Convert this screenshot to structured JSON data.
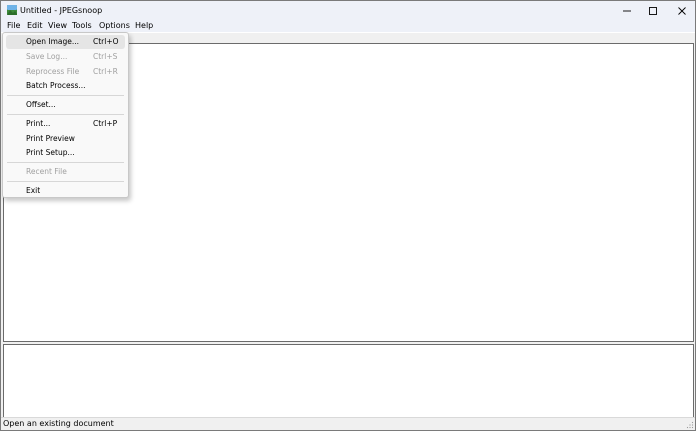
{
  "window": {
    "title": "Untitled - JPEGsnoop",
    "app_icon": "jpegsnoop-landscape-icon",
    "controls": [
      "minimize-icon",
      "maximize-icon",
      "close-icon"
    ]
  },
  "menubar": {
    "items": [
      {
        "label": "File"
      },
      {
        "label": "Edit"
      },
      {
        "label": "View"
      },
      {
        "label": "Tools"
      },
      {
        "label": "Options"
      },
      {
        "label": "Help"
      }
    ]
  },
  "file_menu": {
    "items": [
      {
        "label": "Open Image...",
        "shortcut": "Ctrl+O",
        "enabled": true,
        "highlighted": true
      },
      {
        "label": "Save Log...",
        "shortcut": "Ctrl+S",
        "enabled": false
      },
      {
        "label": "Reprocess File",
        "shortcut": "Ctrl+R",
        "enabled": false
      },
      {
        "label": "Batch Process...",
        "shortcut": "",
        "enabled": true
      },
      {
        "label": "Offset...",
        "shortcut": "",
        "enabled": true
      },
      {
        "label": "Print...",
        "shortcut": "Ctrl+P",
        "enabled": true
      },
      {
        "label": "Print Preview",
        "shortcut": "",
        "enabled": true
      },
      {
        "label": "Print Setup...",
        "shortcut": "",
        "enabled": true
      },
      {
        "label": "Recent File",
        "shortcut": "",
        "enabled": false
      },
      {
        "label": "Exit",
        "shortcut": "",
        "enabled": true
      }
    ]
  },
  "statusbar": {
    "text": "Open an existing document"
  },
  "colors": {
    "titlebar_bg": "#eef1f8",
    "menu_bg": "#f9f9f9",
    "menu_highlight": "#e5e5e5",
    "disabled_text": "#a0a0a0"
  }
}
